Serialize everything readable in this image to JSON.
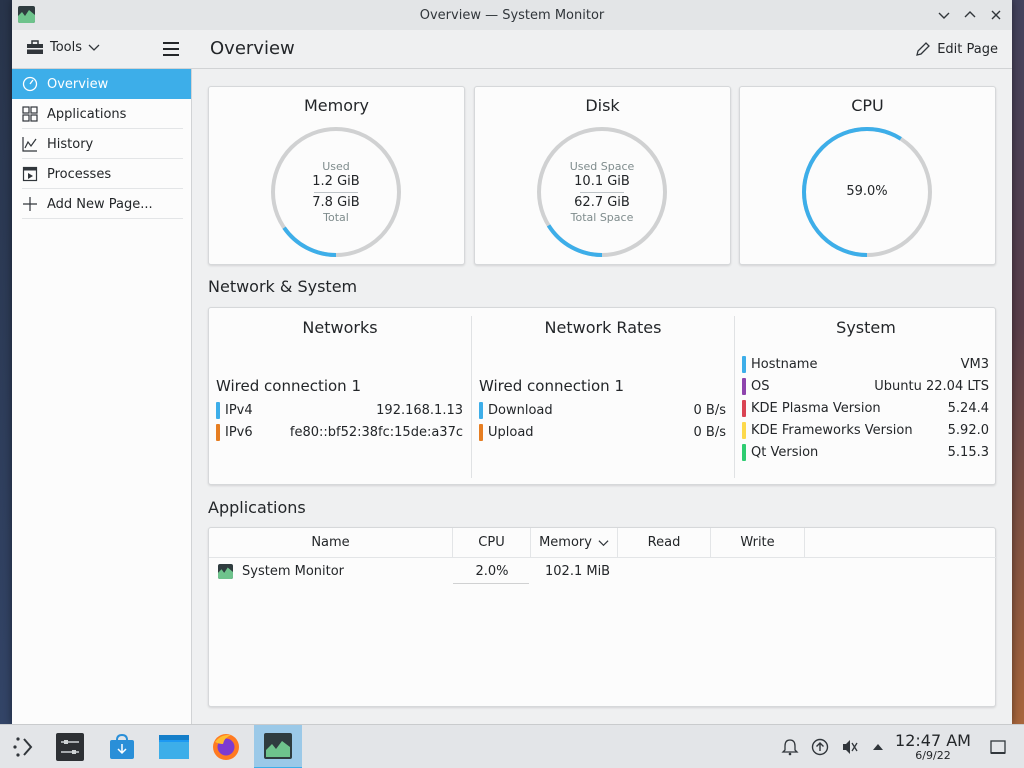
{
  "window": {
    "title": "Overview — System Monitor"
  },
  "toolbar": {
    "tools_label": "Tools",
    "page_title": "Overview",
    "edit_page_label": "Edit Page"
  },
  "sidebar": {
    "items": [
      {
        "label": "Overview",
        "icon": "overview-icon",
        "active": true
      },
      {
        "label": "Applications",
        "icon": "applications-grid-icon"
      },
      {
        "label": "History",
        "icon": "history-chart-icon"
      },
      {
        "label": "Processes",
        "icon": "processes-icon"
      },
      {
        "label": "Add New Page...",
        "icon": "plus-icon"
      }
    ]
  },
  "cards": {
    "memory": {
      "title": "Memory",
      "used_label": "Used",
      "used": "1.2 GiB",
      "total": "7.8 GiB",
      "total_label": "Total",
      "fraction": 0.154
    },
    "disk": {
      "title": "Disk",
      "used_label": "Used Space",
      "used": "10.1 GiB",
      "total": "62.7 GiB",
      "total_label": "Total Space",
      "fraction": 0.161
    },
    "cpu": {
      "title": "CPU",
      "value": "59.0%",
      "fraction": 0.59
    }
  },
  "network_system": {
    "section_title": "Network & System",
    "networks": {
      "title": "Networks",
      "connection": "Wired connection 1",
      "rows": [
        {
          "key": "IPv4",
          "value": "192.168.1.13",
          "color": "#3daee9"
        },
        {
          "key": "IPv6",
          "value": "fe80::bf52:38fc:15de:a37c",
          "color": "#e67e22"
        }
      ]
    },
    "rates": {
      "title": "Network Rates",
      "connection": "Wired connection 1",
      "rows": [
        {
          "key": "Download",
          "value": "0 B/s",
          "color": "#3daee9"
        },
        {
          "key": "Upload",
          "value": "0 B/s",
          "color": "#e67e22"
        }
      ]
    },
    "system": {
      "title": "System",
      "rows": [
        {
          "key": "Hostname",
          "value": "VM3",
          "color": "#3daee9"
        },
        {
          "key": "OS",
          "value": "Ubuntu 22.04 LTS",
          "color": "#8e44ad"
        },
        {
          "key": "KDE Plasma Version",
          "value": "5.24.4",
          "color": "#da4453"
        },
        {
          "key": "KDE Frameworks Version",
          "value": "5.92.0",
          "color": "#fdd94b"
        },
        {
          "key": "Qt Version",
          "value": "5.15.3",
          "color": "#2ecc71"
        }
      ]
    }
  },
  "applications": {
    "section_title": "Applications",
    "columns": [
      "Name",
      "CPU",
      "Memory",
      "Read",
      "Write"
    ],
    "sort_column": "Memory",
    "rows": [
      {
        "name": "System Monitor",
        "cpu": "2.0%",
        "memory": "102.1 MiB",
        "read": "",
        "write": ""
      }
    ]
  },
  "taskbar": {
    "apps": [
      "application-launcher-icon",
      "system-settings-icon",
      "discover-store-icon",
      "dolphin-files-icon",
      "firefox-icon",
      "system-monitor-icon"
    ],
    "clock_time": "12:47 AM",
    "clock_date": "6/9/22"
  },
  "colors": {
    "accent": "#3daee9",
    "gauge_track": "#d0d1d2"
  }
}
